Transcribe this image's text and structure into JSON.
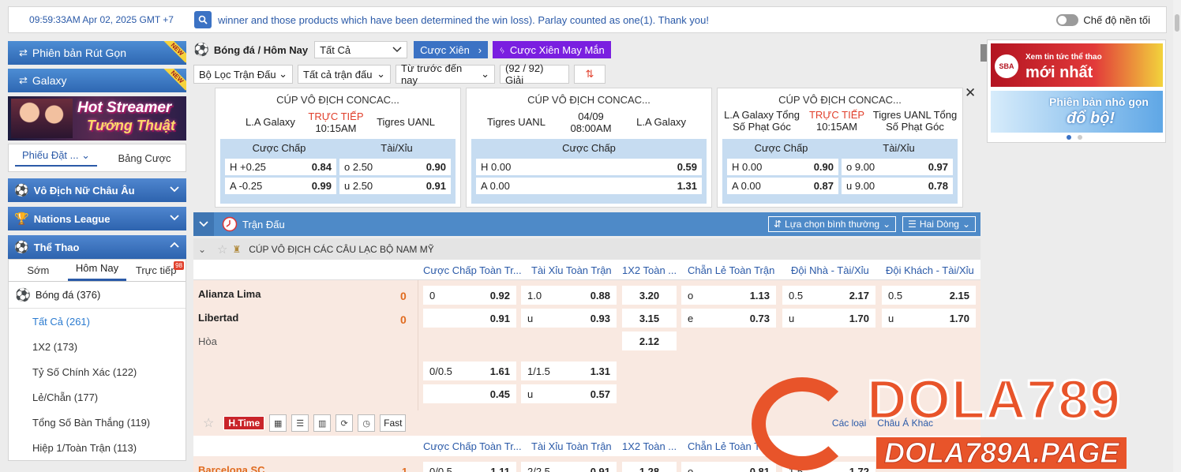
{
  "topbar": {
    "time": "09:59:33AM Apr 02, 2025 GMT +7",
    "marquee": "winner and those products which have been determined the win loss). Parlay counted as one(1). Thank you!",
    "night_mode": "Chế độ nền tối"
  },
  "sidebar": {
    "version_short": "Phiên bản Rút Gọn",
    "galaxy": "Galaxy",
    "new_badge": "NEW",
    "banner_line1": "Hot Streamer",
    "banner_line2": "Tướng Thuật",
    "tab_slip": "Phiếu Đặt ...",
    "tab_board": "Bảng Cược",
    "leagues": [
      "Vô Địch Nữ Châu Âu",
      "Nations League",
      "Thể Thao"
    ],
    "sport_tabs": [
      "Sớm",
      "Hôm Nay",
      "Trực tiếp"
    ],
    "live_badge": "98",
    "sport": "Bóng đá",
    "sport_count": "(376)",
    "subitems": [
      {
        "label": "Tất Cả",
        "count": "(261)"
      },
      {
        "label": "1X2",
        "count": "(173)"
      },
      {
        "label": "Tỷ Số Chính Xác",
        "count": "(122)"
      },
      {
        "label": "Lẻ/Chẵn",
        "count": "(177)"
      },
      {
        "label": "Tổng Số Bàn Thắng",
        "count": "(119)"
      },
      {
        "label": "Hiệp 1/Toàn Trận",
        "count": "(113)"
      }
    ]
  },
  "toolbar": {
    "title": "Bóng đá / Hôm Nay",
    "filter_all": "Tất Cả",
    "parlay": "Cược Xiên",
    "lucky_parlay": "Cược Xiên May Mắn",
    "match_filter": "Bộ Lọc Trận Đấu",
    "all_matches": "Tất cả trận đấu",
    "time_order": "Từ trước đến nay",
    "tournaments": "(92 / 92) Giải"
  },
  "cards": [
    {
      "title": "CÚP VÔ ĐỊCH CONCAC...",
      "home": "L.A Galaxy",
      "away": "Tigres UANL",
      "status": "TRỰC TIẾP",
      "time": "10:15AM",
      "h1": "Cược Chấp",
      "h2": "Tài/Xỉu",
      "rows": [
        [
          {
            "l": "H",
            "v": "+0.25",
            "o": "0.84"
          },
          {
            "l": "o",
            "v": "2.50",
            "o": "0.90"
          }
        ],
        [
          {
            "l": "A",
            "v": "-0.25",
            "o": "0.99"
          },
          {
            "l": "u",
            "v": "2.50",
            "o": "0.91"
          }
        ]
      ]
    },
    {
      "title": "CÚP VÔ ĐỊCH CONCAC...",
      "home": "Tigres UANL",
      "away": "L.A Galaxy",
      "status": "04/09",
      "time": "08:00AM",
      "h1": "Cược Chấp",
      "rows": [
        [
          {
            "l": "H",
            "v": "0.00",
            "o": "0.59"
          }
        ],
        [
          {
            "l": "A",
            "v": "0.00",
            "o": "1.31"
          }
        ]
      ]
    },
    {
      "title": "CÚP VÔ ĐỊCH CONCAC...",
      "home": "L.A Galaxy Tổng Số Phạt Góc",
      "away": "Tigres UANL Tổng Số Phạt Góc",
      "status": "TRỰC TIẾP",
      "time": "10:15AM",
      "h1": "Cược Chấp",
      "h2": "Tài/Xỉu",
      "rows": [
        [
          {
            "l": "H",
            "v": "0.00",
            "o": "0.90"
          },
          {
            "l": "o",
            "v": "9.00",
            "o": "0.97"
          }
        ],
        [
          {
            "l": "A",
            "v": "0.00",
            "o": "0.87"
          },
          {
            "l": "u",
            "v": "9.00",
            "o": "0.78"
          }
        ]
      ]
    }
  ],
  "ads": {
    "ad1_small": "Xem tin tức thể thao",
    "ad1_big": "mới nhất",
    "ad1_logo": "SBA",
    "ad2_small": "Phiên bản nhỏ gọn",
    "ad2_big": "đổ bộ!"
  },
  "match_section": {
    "title": "Trận Đấu",
    "dropdown1": "Lựa chọn bình thường",
    "dropdown2": "Hai Dòng",
    "league": "CÚP VÔ ĐỊCH CÁC CÂU LẠC BỘ NAM MỸ",
    "columns": [
      "Cược Chấp Toàn Tr...",
      "Tài Xỉu Toàn Trận",
      "1X2 Toàn ...",
      "Chẵn Lẻ Toàn Trận",
      "Đội Nhà - Tài/Xỉu",
      "Đội Khách - Tài/Xỉu"
    ],
    "home": "Alianza Lima",
    "away": "Libertad",
    "draw": "Hòa",
    "home_score": "0",
    "away_score": "0",
    "odds": {
      "hdp_line": "0",
      "hdp_home": "0.92",
      "hdp_away": "0.91",
      "ou_line": "1.0",
      "ou_over": "0.88",
      "ou_u": "u",
      "ou_under": "0.93",
      "x1": "3.20",
      "x2": "3.15",
      "xd": "2.12",
      "oe_o": "o",
      "oe_o_val": "1.13",
      "oe_e": "e",
      "oe_e_val": "0.73",
      "h_line": "0.5",
      "h_over": "2.17",
      "h_u": "u",
      "h_under": "1.70",
      "a_line": "0.5",
      "a_over": "2.15",
      "a_u": "u",
      "a_under": "1.70",
      "hdp2_line": "0/0.5",
      "hdp2_home": "1.61",
      "hdp2_away": "0.45",
      "ou2_line": "1/1.5",
      "ou2_over": "1.31",
      "ou2_u": "u",
      "ou2_under": "0.57"
    },
    "htime": "H.Time",
    "fast": "Fast",
    "more1": "Các loại",
    "more2": "Châu Á Khác",
    "next_home": "Barcelona SC",
    "next_score": "1",
    "next_hdp_line": "0/0.5",
    "next_hdp": "1.11",
    "next_ou_line": "2/2.5",
    "next_ou": "0.91",
    "next_x": "1.28",
    "next_oe": "o",
    "next_oe_val": "0.81",
    "next_h_line": "1.5",
    "next_h": "1.72"
  },
  "watermark": {
    "brand": "DOLA789",
    "site": "DOLA789A.PAGE"
  }
}
